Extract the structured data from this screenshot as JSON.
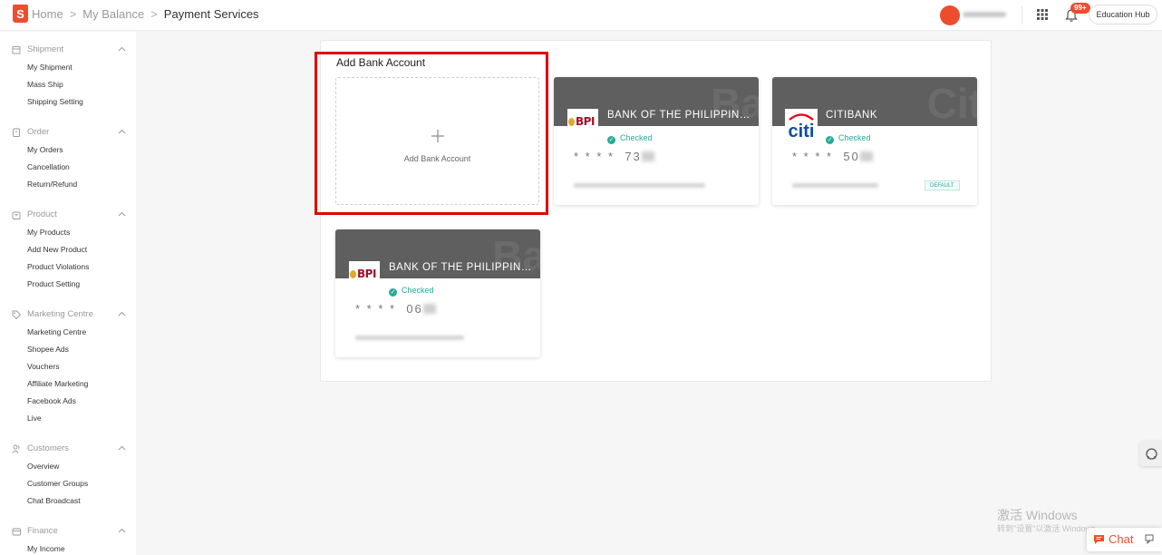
{
  "header": {
    "logo_letter": "S",
    "breadcrumb": [
      "Home",
      "My Balance",
      "Payment Services"
    ],
    "notification_count": "99+",
    "education_hub": "Education Hub"
  },
  "sidebar": {
    "groups": [
      {
        "title": "Shipment",
        "icon": "box-icon",
        "items": [
          "My Shipment",
          "Mass Ship",
          "Shipping Setting"
        ]
      },
      {
        "title": "Order",
        "icon": "clipboard-icon",
        "items": [
          "My Orders",
          "Cancellation",
          "Return/Refund"
        ]
      },
      {
        "title": "Product",
        "icon": "bag-icon",
        "items": [
          "My Products",
          "Add New Product",
          "Product Violations",
          "Product Setting"
        ]
      },
      {
        "title": "Marketing Centre",
        "icon": "tag-icon",
        "items": [
          "Marketing Centre",
          "Shopee Ads",
          "Vouchers",
          "Affiliate Marketing",
          "Facebook Ads",
          "Live"
        ]
      },
      {
        "title": "Customers",
        "icon": "people-icon",
        "items": [
          "Overview",
          "Customer Groups",
          "Chat Broadcast"
        ]
      },
      {
        "title": "Finance",
        "icon": "wallet-icon",
        "items": [
          "My Income"
        ]
      }
    ]
  },
  "main": {
    "title": "Add Bank Account",
    "add_card_label": "Add Bank Account",
    "accounts": [
      {
        "bank": "BANK OF THE PHILIPPINE ...",
        "ghost": "Ba",
        "logo": "bpi",
        "logo_text": "BPI",
        "status": "Checked",
        "masked": "* * * *",
        "digits": "73",
        "default": ""
      },
      {
        "bank": "CITIBANK",
        "ghost": "Cit",
        "logo": "citi",
        "logo_text": "citi",
        "status": "Checked",
        "masked": "* * * *",
        "digits": "50",
        "default": "DEFAULT"
      },
      {
        "bank": "BANK OF THE PHILIPPINE ...",
        "ghost": "Ba",
        "logo": "bpi",
        "logo_text": "BPI",
        "status": "Checked",
        "masked": "* * * *",
        "digits": "06",
        "default": ""
      }
    ]
  },
  "overlay": {
    "watermark_title": "激活 Windows",
    "watermark_sub": "转到\"设置\"以激活 Windows。",
    "chat_label": "Chat"
  },
  "colors": {
    "brand": "#ee4d2d",
    "checked": "#26aa99",
    "highlight": "#e00000",
    "card_header": "#5f5f5f"
  }
}
